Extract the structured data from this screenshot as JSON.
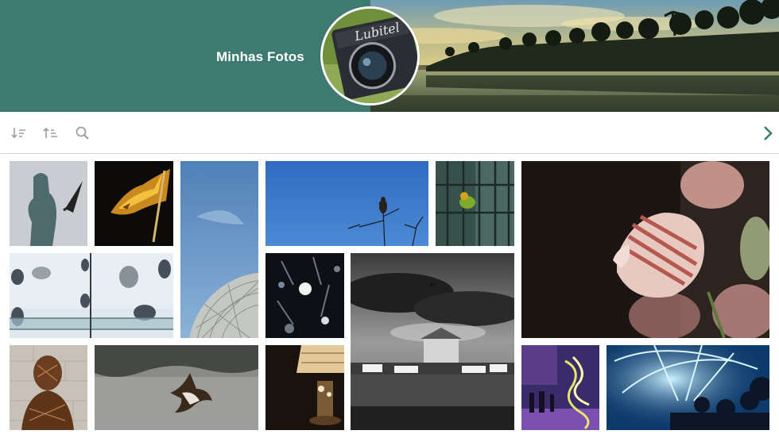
{
  "header": {
    "title": "Minhas Fotos",
    "avatar_icon": "vintage-camera",
    "avatar_label": "Lubitel",
    "cover_scene": "beach-palm-trees-sunset",
    "accent_color": "#3f7a72"
  },
  "toolbar": {
    "sort_desc_icon": "sort-descending-icon",
    "sort_asc_icon": "sort-ascending-icon",
    "search_icon": "search-icon",
    "next_icon": "chevron-right-icon",
    "icon_color": "#9aa0a4",
    "next_color": "#3f7a72"
  },
  "gallery": {
    "photos": [
      {
        "subject": "statue-with-arrow"
      },
      {
        "subject": "tattered-flag-golden"
      },
      {
        "subject": "geodesic-dome-sky"
      },
      {
        "subject": "bird-on-branch-blue-sky"
      },
      {
        "subject": "green-bird-in-cage"
      },
      {
        "subject": "striped-fabric-tulip"
      },
      {
        "subject": "glass-shelf-frosted-window"
      },
      {
        "subject": "bokeh-crystal-lights"
      },
      {
        "subject": "harbor-tower-boats-bw"
      },
      {
        "subject": "wicker-sculpture-head"
      },
      {
        "subject": "hawk-flying-over-water"
      },
      {
        "subject": "table-lamp-dark"
      },
      {
        "subject": "neon-light-installation"
      },
      {
        "subject": "blue-light-dome-crowd"
      }
    ]
  }
}
